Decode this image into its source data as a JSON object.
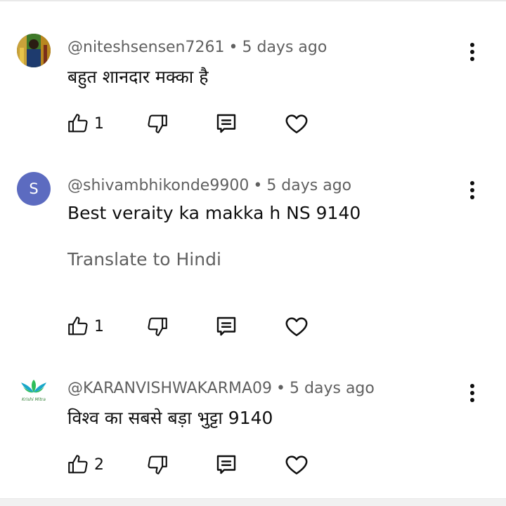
{
  "comments": [
    {
      "username": "@niteshsensen7261",
      "separator": "•",
      "time": "5 days ago",
      "text": "बहुत शानदार मक्का है",
      "likes": "1",
      "avatar_type": "photo"
    },
    {
      "username": "@shivambhikonde9900",
      "separator": "•",
      "time": "5 days ago",
      "text": "Best veraity ka makka h NS 9140",
      "translate": "Translate to Hindi",
      "likes": "1",
      "avatar_letter": "S",
      "avatar_color": "#5c6bc0"
    },
    {
      "username": "@KARANVISHWAKARMA09",
      "separator": "•",
      "time": "5 days ago",
      "text": "विश्व का सबसे बड़ा भुट्टा 9140",
      "likes": "2",
      "avatar_type": "logo",
      "avatar_logo_text": "Krishi Mitra"
    }
  ],
  "icons": {
    "like": "thumbs-up-icon",
    "dislike": "thumbs-down-icon",
    "reply": "reply-icon",
    "heart": "heart-icon",
    "more": "more-vertical-icon"
  }
}
